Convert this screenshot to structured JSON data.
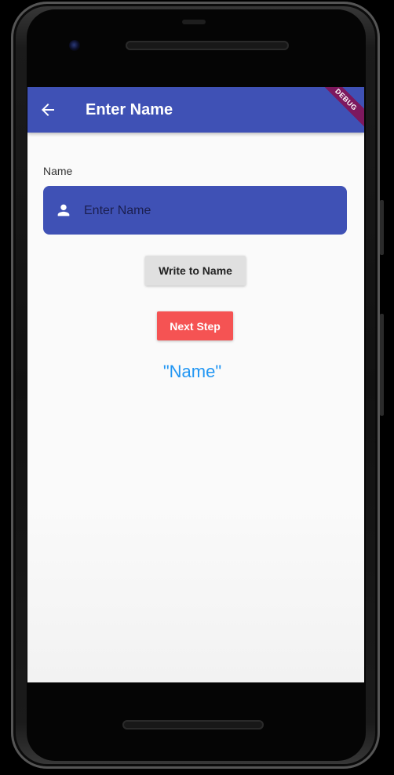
{
  "appbar": {
    "title": "Enter Name",
    "debug_label": "DEBUG"
  },
  "form": {
    "field_label": "Name",
    "input_placeholder": "Enter Name",
    "input_value": ""
  },
  "buttons": {
    "write_label": "Write to Name",
    "next_label": "Next Step"
  },
  "output": {
    "name_text": "\"Name\""
  },
  "icons": {
    "back": "arrow-back-icon",
    "person": "person-icon",
    "camera": "camera-icon"
  },
  "colors": {
    "primary": "#3f51b5",
    "accent_red": "#f55353",
    "output_blue": "#2196f3",
    "button_grey": "#e0e0e0",
    "debug_banner": "#880e4f"
  }
}
